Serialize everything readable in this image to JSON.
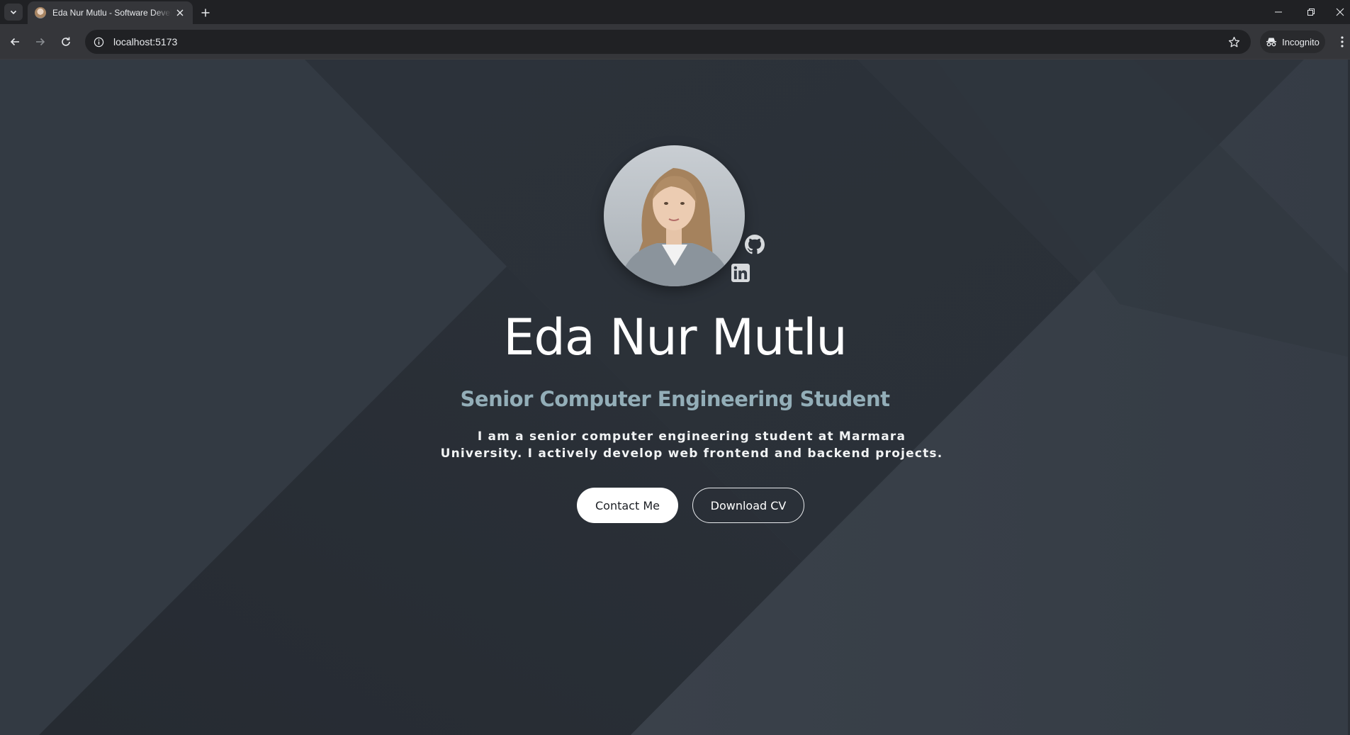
{
  "browser": {
    "tab_title": "Eda Nur Mutlu - Software Developer",
    "url": "localhost:5173",
    "incognito_label": "Incognito"
  },
  "hero": {
    "name": "Eda Nur Mutlu",
    "subtitle": "Senior Computer Engineering Student",
    "bio": "I am a senior computer engineering student at Marmara University. I actively develop web frontend and backend projects.",
    "primary_button": "Contact Me",
    "secondary_button": "Download CV"
  },
  "social": [
    "github-icon",
    "linkedin-icon"
  ],
  "colors": {
    "background": "#333a43",
    "subtitle": "#93aeb8",
    "text": "#ffffff",
    "chrome": "#202124",
    "toolbar": "#35363a"
  }
}
